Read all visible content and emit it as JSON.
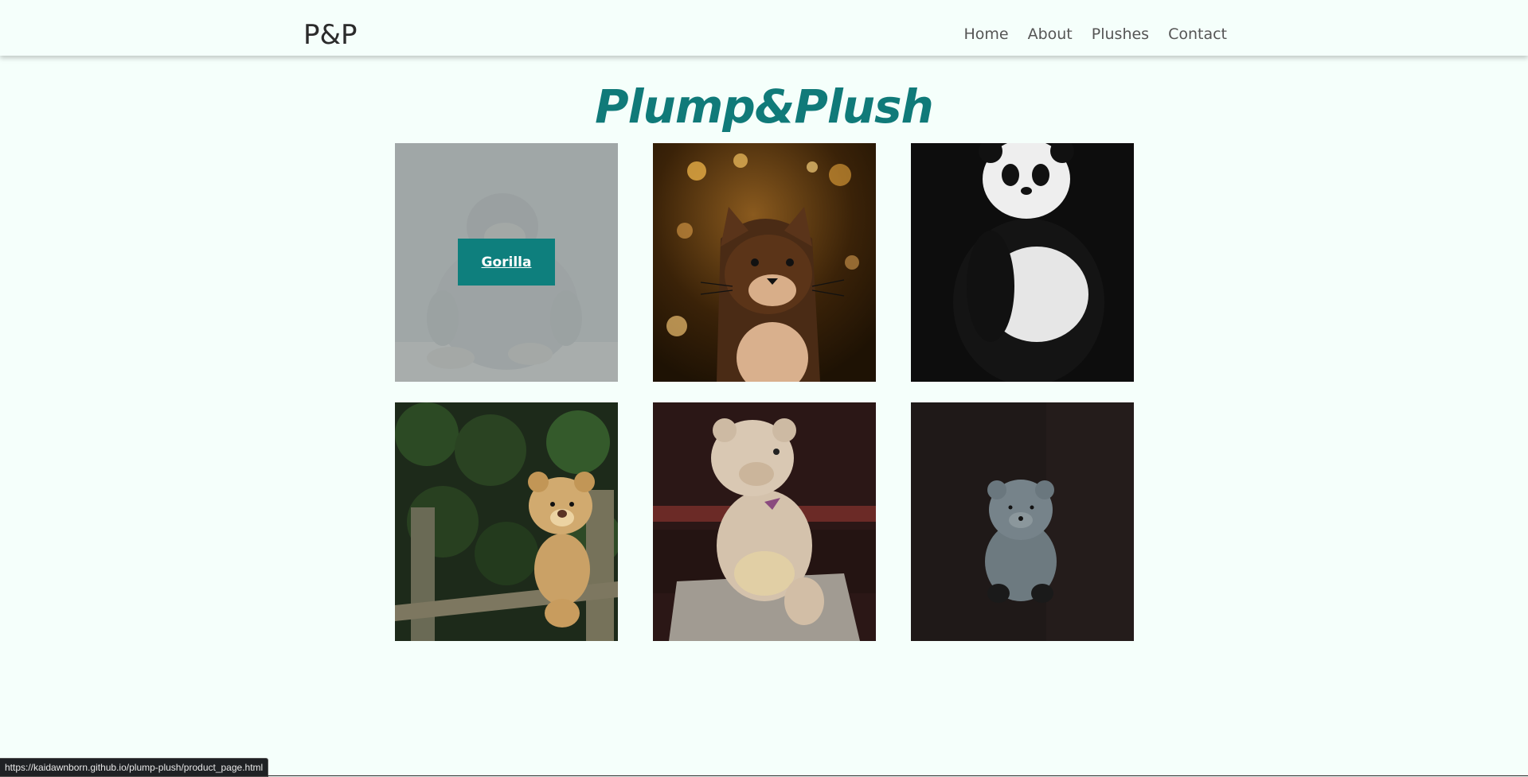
{
  "navbar": {
    "brand": "P&P",
    "links": [
      "Home",
      "About",
      "Plushes",
      "Contact"
    ]
  },
  "hero": {
    "title": "Plump&Plush"
  },
  "plushes": [
    {
      "name": "gorilla",
      "label": "Gorilla",
      "hovered": true
    },
    {
      "name": "cat",
      "label": "",
      "hovered": false
    },
    {
      "name": "panda",
      "label": "",
      "hovered": false
    },
    {
      "name": "teddy-bear-fence",
      "label": "",
      "hovered": false
    },
    {
      "name": "teddy-bear-rock",
      "label": "",
      "hovered": false
    },
    {
      "name": "blue-bear",
      "label": "",
      "hovered": false
    }
  ],
  "status_bar": {
    "url": "https://kaidawnborn.github.io/plump-plush/product_page.html"
  },
  "colors": {
    "background": "#f5fffb",
    "accent": "#107a79",
    "label_bg": "#0e7f7d"
  }
}
